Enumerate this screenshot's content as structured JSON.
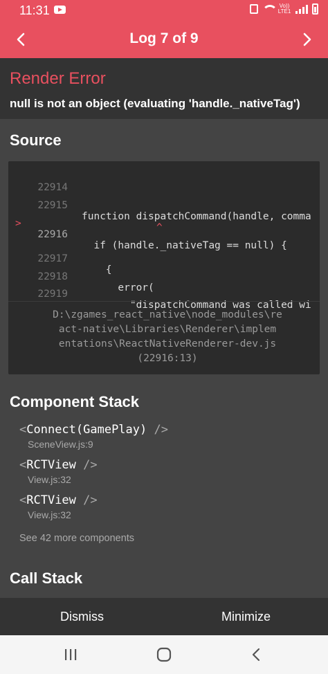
{
  "status_bar": {
    "time": "11:31",
    "network_label_top": "Vo))",
    "network_label_bottom": "LTE1"
  },
  "header": {
    "title": "Log 7 of 9",
    "prev_icon": "chevron-left-icon",
    "next_icon": "chevron-right-icon"
  },
  "error": {
    "heading": "Render Error",
    "message": "null is not an object (evaluating 'handle._nativeTag')"
  },
  "source": {
    "title": "Source",
    "lines": [
      {
        "num": "22914",
        "text": ""
      },
      {
        "num": "22915",
        "text": "function dispatchCommand(handle, comma"
      },
      {
        "num": "22916",
        "text": "  if (handle._nativeTag == null) {",
        "marker": ">"
      },
      {
        "num": "22917",
        "text": "    {"
      },
      {
        "num": "22918",
        "text": "      error("
      },
      {
        "num": "22919",
        "text": "        \"dispatchCommand was called wi"
      }
    ],
    "caret": "^",
    "file_path": "D:\\zgames_react_native\\node_modules\\react-native\\Libraries\\Renderer\\implementations\\ReactNativeRenderer-dev.js",
    "file_path_lines": [
      "D:\\zgames_react_native\\node_modules\\re",
      "act-native\\Libraries\\Renderer\\implem",
      "entations\\ReactNativeRenderer-dev.js",
      "(22916:13)"
    ]
  },
  "component_stack": {
    "title": "Component Stack",
    "items": [
      {
        "open": "<",
        "name": "Connect(GamePlay)",
        "close": " />",
        "location": "SceneView.js:9"
      },
      {
        "open": "<",
        "name": "RCTView",
        "close": " />",
        "location": "View.js:32"
      },
      {
        "open": "<",
        "name": "RCTView",
        "close": " />",
        "location": "View.js:32"
      }
    ],
    "see_more": "See 42 more components"
  },
  "call_stack": {
    "title": "Call Stack"
  },
  "footer": {
    "dismiss_label": "Dismiss",
    "minimize_label": "Minimize"
  },
  "colors": {
    "accent": "#e8505f",
    "background": "#444444",
    "panel": "#333333",
    "code_bg": "#2b2b2b"
  }
}
